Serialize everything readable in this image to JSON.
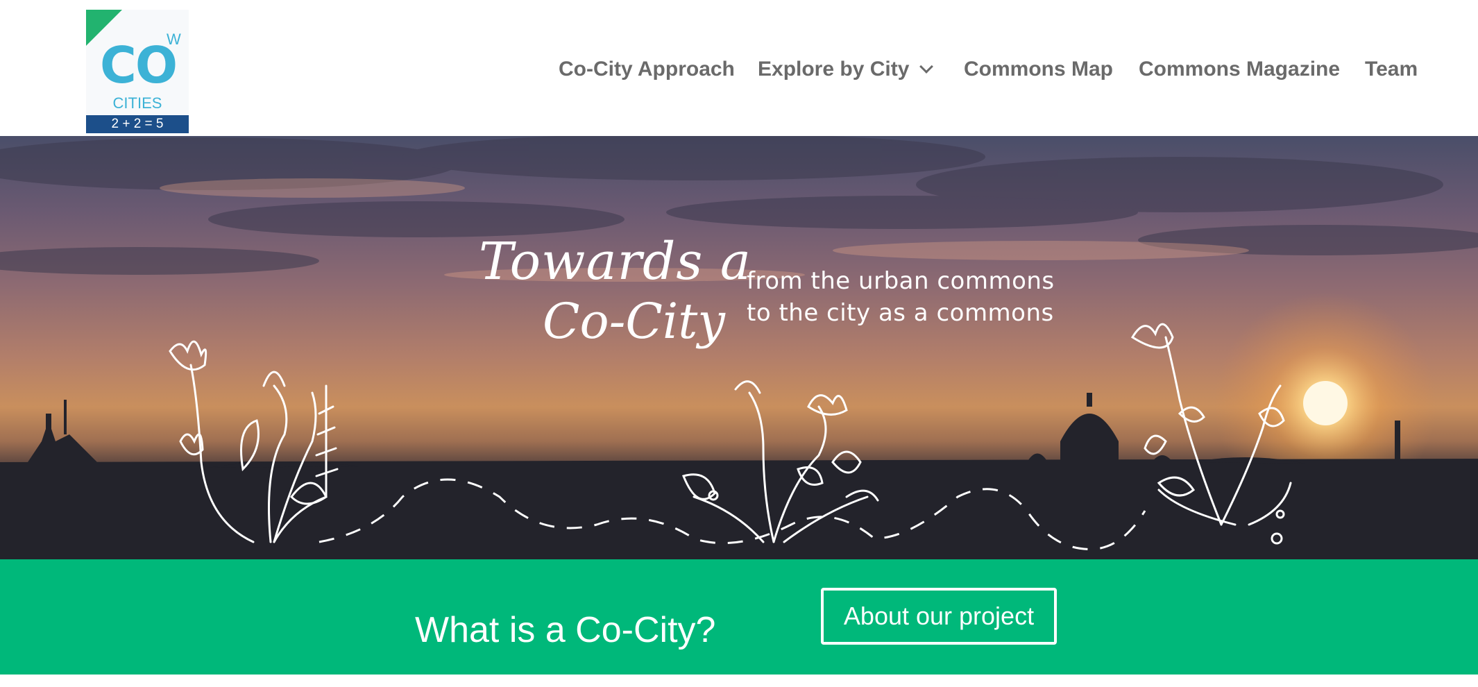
{
  "logo": {
    "letters": "CO",
    "superscript": "W",
    "line2": "CITIES",
    "equation": "2 + 2 = 5"
  },
  "nav": {
    "items": [
      {
        "label": "Co-City Approach"
      },
      {
        "label": "Explore by City",
        "has_dropdown": true
      },
      {
        "label": "Commons Map"
      },
      {
        "label": "Commons Magazine"
      },
      {
        "label": "Team"
      }
    ]
  },
  "hero": {
    "script_line1": "Towards a",
    "script_line2": "Co-City",
    "tagline_line1": "from the urban commons",
    "tagline_line2": "to the city as a commons"
  },
  "cta": {
    "title": "What is a Co-City?",
    "button_label": "About our project"
  },
  "colors": {
    "brand_green": "#00b87a",
    "logo_blue": "#3cb2d6",
    "nav_text": "#6a6a6a"
  }
}
